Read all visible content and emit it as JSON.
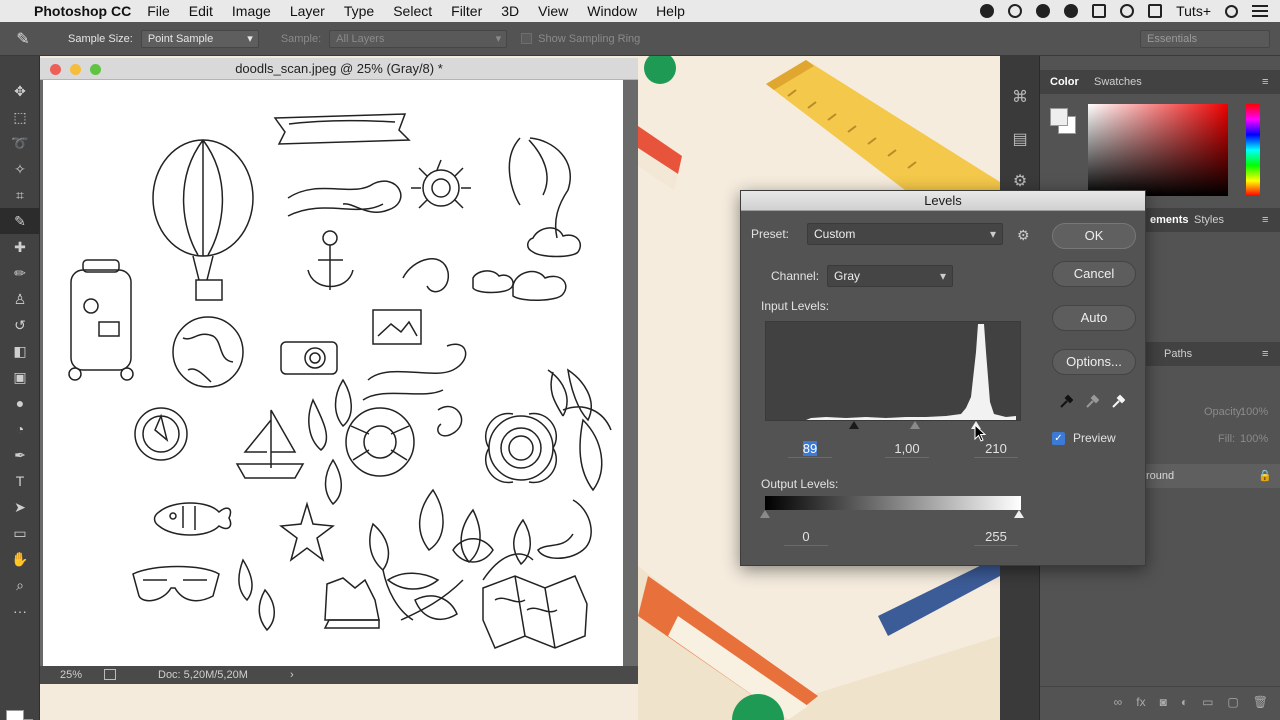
{
  "menubar": {
    "app_name": "Photoshop CC",
    "items": [
      "File",
      "Edit",
      "Image",
      "Layer",
      "Type",
      "Select",
      "Filter",
      "3D",
      "View",
      "Window",
      "Help"
    ],
    "user": "Tuts+"
  },
  "options_bar": {
    "sample_size_label": "Sample Size:",
    "sample_size_value": "Point Sample",
    "sample_label": "Sample:",
    "sample_value": "All Layers",
    "show_ring_label": "Show Sampling Ring",
    "workspace": "Essentials"
  },
  "document": {
    "title": "doodls_scan.jpeg @ 25% (Gray/8) *",
    "zoom": "25%",
    "doc_size": "Doc: 5,20M/5,20M"
  },
  "panels": {
    "color_tab": "Color",
    "swatches_tab": "Swatches",
    "adjustments_tab": "ements",
    "styles_tab": "Styles",
    "paths_tab": "Paths",
    "opacity_label": "Opacity:",
    "opacity_value": "100%",
    "fill_label": "Fill:",
    "fill_value": "100%",
    "layer_name": "round"
  },
  "levels": {
    "title": "Levels",
    "preset_label": "Preset:",
    "preset_value": "Custom",
    "channel_label": "Channel:",
    "channel_value": "Gray",
    "input_levels_label": "Input Levels:",
    "input_black": "89",
    "input_mid": "1,00",
    "input_white": "210",
    "output_levels_label": "Output Levels:",
    "output_black": "0",
    "output_white": "255",
    "ok": "OK",
    "cancel": "Cancel",
    "auto": "Auto",
    "options": "Options...",
    "preview_label": "Preview",
    "preview_checked": true,
    "input_black_level": 89,
    "input_white_level": 210,
    "input_gamma": 1.0,
    "output_black_level": 0,
    "output_white_level": 255
  }
}
